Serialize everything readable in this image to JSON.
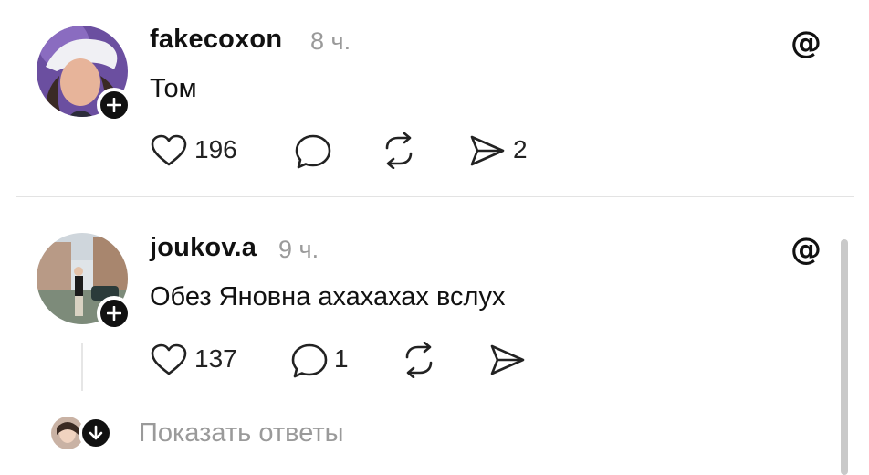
{
  "posts": [
    {
      "username": "fakecoxon",
      "time": "8 ч.",
      "text": "Том",
      "likes": "196",
      "comments": "",
      "shares": "2",
      "icons": [
        "heart-icon",
        "comment-icon",
        "repost-icon",
        "share-icon",
        "threads-logo-icon",
        "follow-plus-icon"
      ]
    },
    {
      "username": "joukov.a",
      "time": "9 ч.",
      "text": "Обез Яновна ахахахах вслух",
      "likes": "137",
      "comments": "1",
      "shares": "",
      "icons": [
        "heart-icon",
        "comment-icon",
        "repost-icon",
        "share-icon",
        "threads-logo-icon",
        "follow-plus-icon"
      ]
    }
  ],
  "replies": {
    "label": "Показать ответы"
  },
  "colors": {
    "text": "#111111",
    "muted": "#9a9a9a",
    "divider": "#e3e3e3",
    "badge": "#111111"
  }
}
